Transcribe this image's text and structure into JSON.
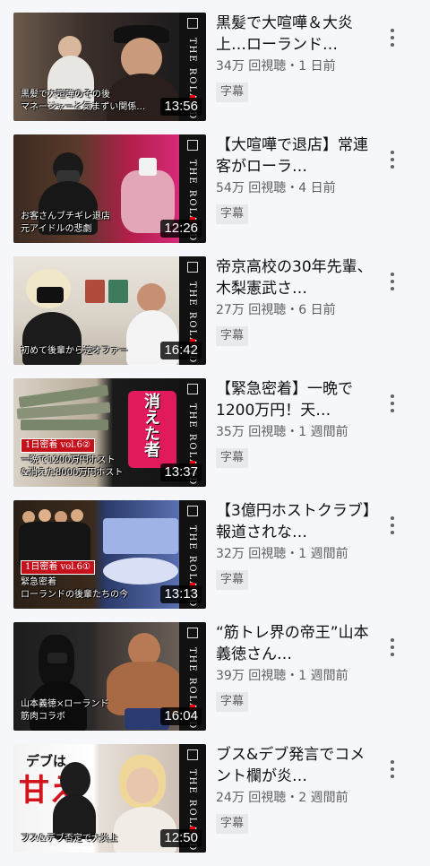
{
  "channel_brand": "THE ROLAND SHOW",
  "colors": {
    "accent_red": "#c4111b",
    "meta_gray": "#606060",
    "background": "#f6f7fb"
  },
  "videos": [
    {
      "title": "黒髪で大喧嘩＆大炎上…ローランド…",
      "stats": "34万 回視聴・1 日前",
      "cc": "字幕",
      "duration": "13:56",
      "caption_lines": [
        "黒髪で大喧嘩のその後",
        "マネージャーと気まずい関係…"
      ]
    },
    {
      "title": "【大喧嘩で退店】常連客がローラ…",
      "stats": "54万 回視聴・4 日前",
      "cc": "字幕",
      "duration": "12:26",
      "caption_lines": [
        "お客さんブチギレ退店",
        "元アイドルの悲劇"
      ]
    },
    {
      "title": "帝京高校の30年先輩、木梨憲武さ…",
      "stats": "27万 回視聴・6 日前",
      "cc": "字幕",
      "duration": "16:42",
      "caption_lines": [
        "初めて後輩から逆オファー"
      ]
    },
    {
      "title": "【緊急密着】一晩で1200万円！天…",
      "stats": "35万 回視聴・1 週間前",
      "cc": "字幕",
      "duration": "13:37",
      "badge": "1日密着 vol.6②",
      "overlay_text": "消えた者",
      "caption_lines": [
        "一晩で1200万円ホスト",
        "&消えた8000万円ホスト"
      ]
    },
    {
      "title": "【3億円ホストクラブ】報道されな…",
      "stats": "32万 回視聴・1 週間前",
      "cc": "字幕",
      "duration": "13:13",
      "badge": "1日密着 vol.6①",
      "caption_lines": [
        "緊急密着",
        "ローランドの後輩たちの今"
      ]
    },
    {
      "title": "“筋トレ界の帝王”山本義徳さん…",
      "stats": "39万 回視聴・1 週間前",
      "cc": "字幕",
      "duration": "16:04",
      "caption_lines": [
        "山本義徳×ローランド",
        "筋肉コラボ"
      ]
    },
    {
      "title": "ブス&デブ発言でコメント欄が炎…",
      "stats": "24万 回視聴・2 週間前",
      "cc": "字幕",
      "duration": "12:50",
      "overlay_top": "デブは",
      "overlay_big": "甘え",
      "caption_lines": [
        "ブス&デブ否定で大炎上"
      ]
    }
  ]
}
